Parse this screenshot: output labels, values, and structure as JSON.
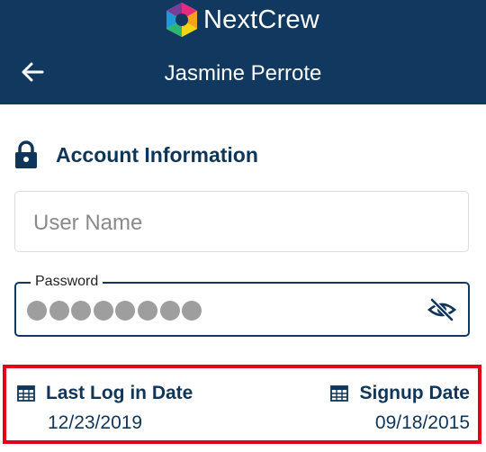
{
  "brand": {
    "name": "NextCrew"
  },
  "header": {
    "title": "Jasmine Perrote",
    "back_icon": "arrow-left-icon"
  },
  "section": {
    "title": "Account Information",
    "icon": "lock-icon"
  },
  "form": {
    "username": {
      "placeholder": "User Name",
      "value": ""
    },
    "password": {
      "label": "Password",
      "masked_length": 8,
      "visibility_icon": "eye-off-icon"
    }
  },
  "dates": {
    "last_login": {
      "label": "Last Log in Date",
      "value": "12/23/2019",
      "icon": "calendar-grid-icon"
    },
    "signup": {
      "label": "Signup Date",
      "value": "09/18/2015",
      "icon": "calendar-grid-icon"
    }
  },
  "colors": {
    "appbar": "#11385f",
    "text_primary": "#0f3558",
    "highlight_border": "#e3001b",
    "password_dot": "#9e9e9e"
  }
}
